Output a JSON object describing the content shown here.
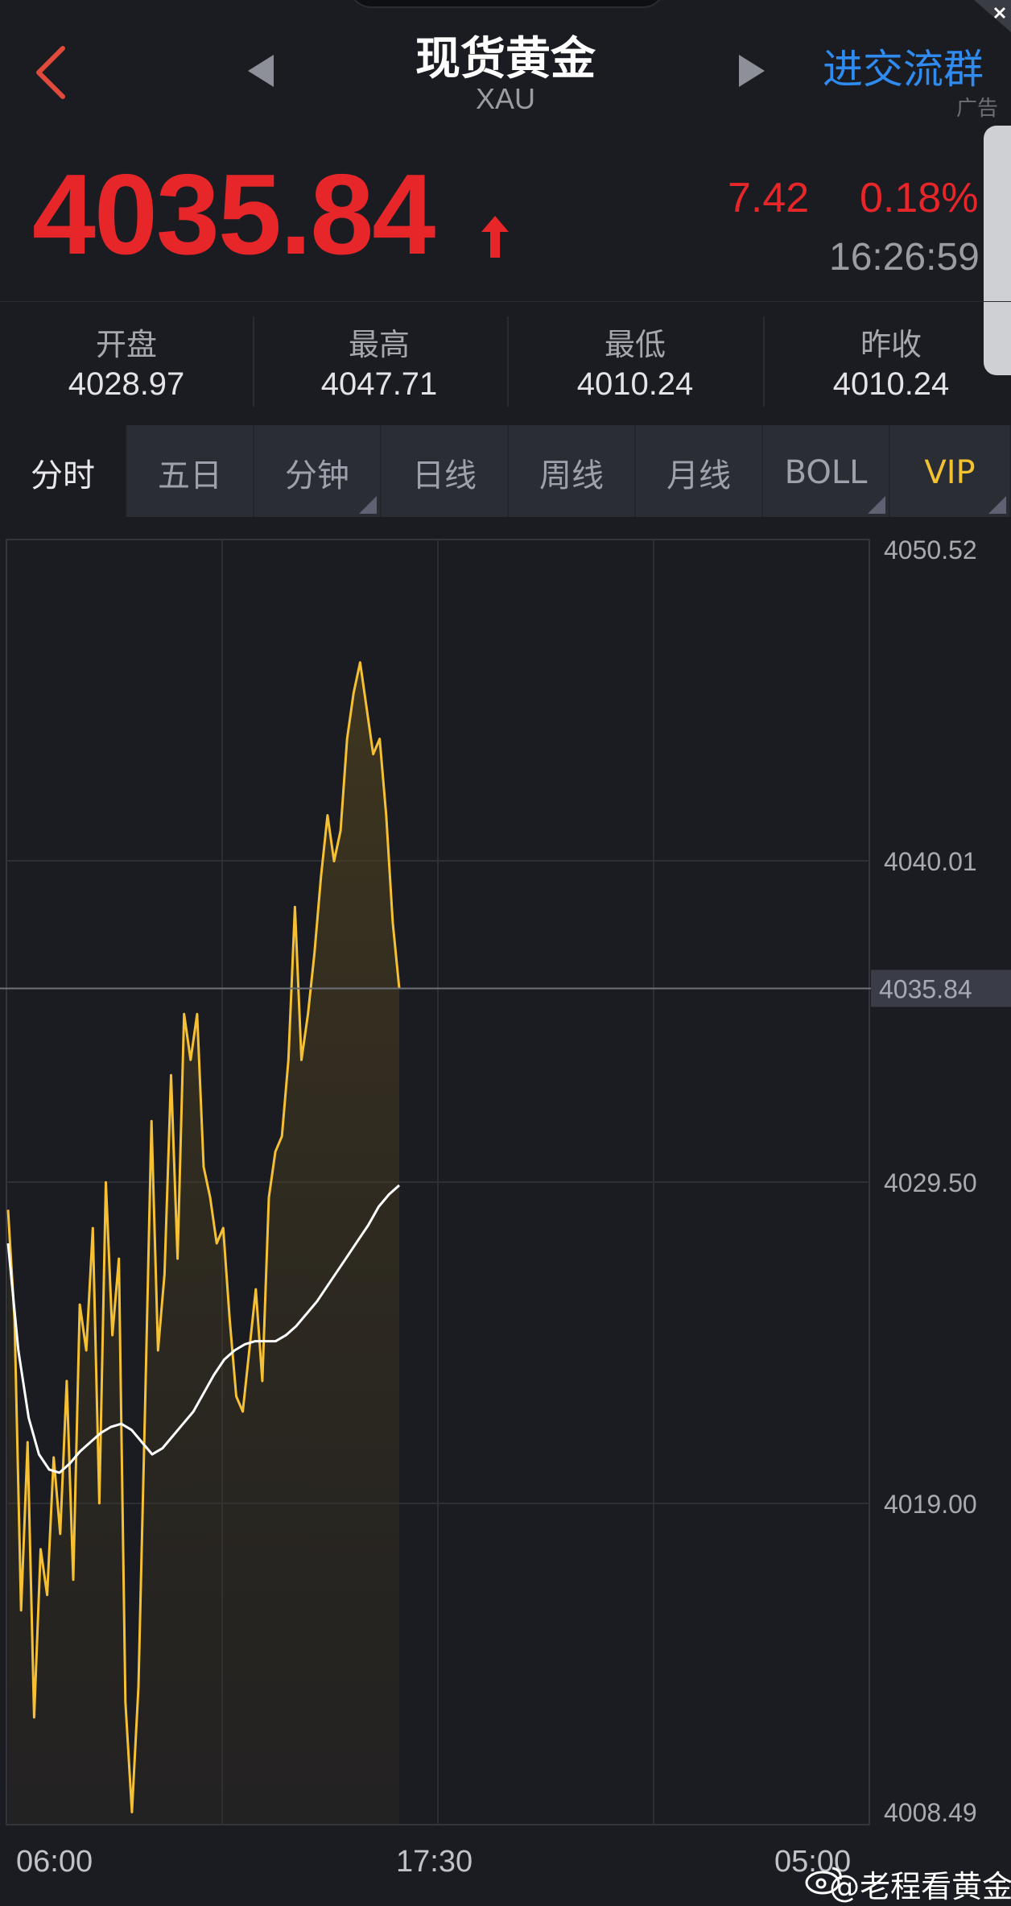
{
  "header": {
    "title": "现货黄金",
    "symbol": "XAU",
    "group_link": "进交流群",
    "ad_label": "广告"
  },
  "quote": {
    "price": "4035.84",
    "change": "7.42",
    "change_pct": "0.18%",
    "time": "16:26:59",
    "up_color": "#e7262a"
  },
  "stats": [
    {
      "label": "开盘",
      "value": "4028.97"
    },
    {
      "label": "最高",
      "value": "4047.71"
    },
    {
      "label": "最低",
      "value": "4010.24"
    },
    {
      "label": "昨收",
      "value": "4010.24"
    }
  ],
  "tabs": [
    {
      "label": "分时",
      "active": true,
      "has_menu": false
    },
    {
      "label": "五日",
      "active": false,
      "has_menu": false
    },
    {
      "label": "分钟",
      "active": false,
      "has_menu": true
    },
    {
      "label": "日线",
      "active": false,
      "has_menu": false
    },
    {
      "label": "周线",
      "active": false,
      "has_menu": false
    },
    {
      "label": "月线",
      "active": false,
      "has_menu": false
    },
    {
      "label": "BOLL",
      "active": false,
      "has_menu": true
    },
    {
      "label": "VIP",
      "active": false,
      "has_menu": true,
      "color": "#f2c230"
    }
  ],
  "chart_data": {
    "type": "line",
    "y_axis_labels": [
      "4050.52",
      "4040.01",
      "4029.50",
      "4019.00",
      "4008.49"
    ],
    "current_price_label": "4035.84",
    "current_price": 4035.84,
    "x_axis_labels": [
      "06:00",
      "17:30",
      "05:00"
    ],
    "ylim": [
      4008.49,
      4050.52
    ],
    "grid": true,
    "series": [
      {
        "color": "#f5c034",
        "values": [
          4028.6,
          4025.0,
          4015.5,
          4021.0,
          4012.0,
          4017.5,
          4016.0,
          4020.5,
          4018.0,
          4023.0,
          4016.5,
          4025.5,
          4024.0,
          4028.0,
          4019.0,
          4029.5,
          4024.5,
          4027.0,
          4012.5,
          4008.9,
          4013.0,
          4022.0,
          4031.5,
          4024.0,
          4026.5,
          4033.0,
          4027.0,
          4035.0,
          4033.5,
          4035.0,
          4030.0,
          4029.0,
          4027.5,
          4028.0,
          4025.0,
          4022.5,
          4022.0,
          4024.0,
          4026.0,
          4023.0,
          4029.0,
          4030.5,
          4031.0,
          4033.5,
          4038.5,
          4033.5,
          4035.0,
          4037.0,
          4039.5,
          4041.5,
          4040.0,
          4041.0,
          4044.0,
          4045.5,
          4046.5,
          4045.0,
          4043.5,
          4044.0,
          4041.5,
          4038.0,
          4035.84
        ]
      },
      {
        "color": "#ffffff",
        "values": [
          4027.5,
          4024.0,
          4021.8,
          4020.6,
          4020.1,
          4020.0,
          4020.3,
          4020.7,
          4021.0,
          4021.3,
          4021.5,
          4021.6,
          4021.4,
          4021.0,
          4020.6,
          4020.8,
          4021.2,
          4021.6,
          4022.0,
          4022.6,
          4023.2,
          4023.7,
          4024.0,
          4024.2,
          4024.3,
          4024.3,
          4024.3,
          4024.5,
          4024.8,
          4025.2,
          4025.6,
          4026.1,
          4026.6,
          4027.1,
          4027.6,
          4028.1,
          4028.7,
          4029.1,
          4029.4
        ]
      }
    ]
  }
}
